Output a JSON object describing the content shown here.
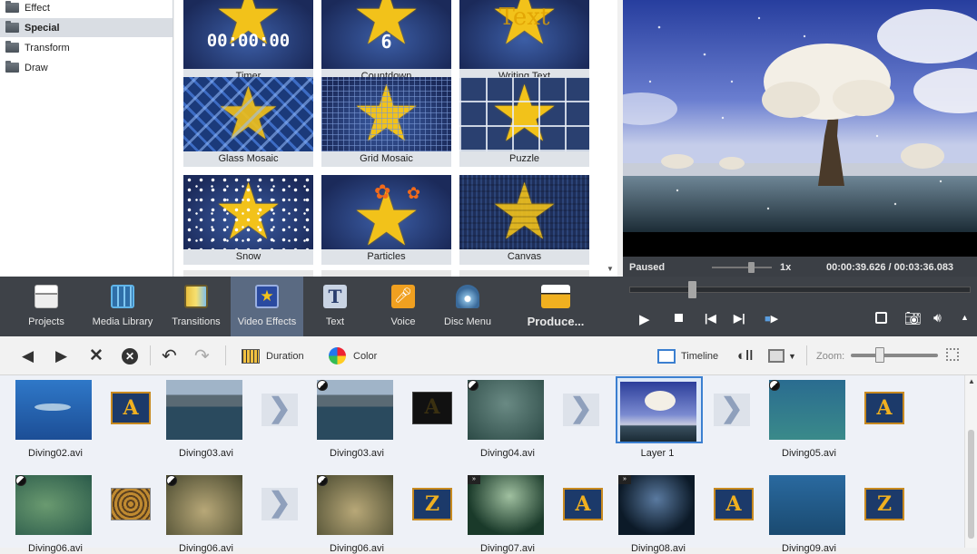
{
  "categories": {
    "items": [
      {
        "label": "Effect",
        "selected": false
      },
      {
        "label": "Special",
        "selected": true
      },
      {
        "label": "Transform",
        "selected": false
      },
      {
        "label": "Draw",
        "selected": false
      }
    ]
  },
  "gallery": {
    "tiles": [
      {
        "label": "Timer",
        "overlay": "00:00:00"
      },
      {
        "label": "Countdown",
        "overlay": "6"
      },
      {
        "label": "Writing Text",
        "overlay": "Text"
      },
      {
        "label": "Glass Mosaic"
      },
      {
        "label": "Grid Mosaic"
      },
      {
        "label": "Puzzle"
      },
      {
        "label": "Snow"
      },
      {
        "label": "Particles"
      },
      {
        "label": "Canvas"
      }
    ]
  },
  "preview": {
    "status": "Paused",
    "speed": "1x",
    "time": "00:00:39.626 / 00:03:36.083"
  },
  "toolbar": {
    "items": [
      {
        "label": "Projects",
        "icon": "clapperboard-icon"
      },
      {
        "label": "Media Library",
        "icon": "film-strip-icon"
      },
      {
        "label": "Transitions",
        "icon": "transitions-icon"
      },
      {
        "label": "Video Effects",
        "icon": "star-effect-icon",
        "active": true
      },
      {
        "label": "Text",
        "icon": "text-t-icon"
      },
      {
        "label": "Voice",
        "icon": "microphone-icon"
      },
      {
        "label": "Disc Menu",
        "icon": "disc-icon"
      },
      {
        "label": "Produce...",
        "icon": "produce-icon"
      }
    ]
  },
  "editbar": {
    "duration_label": "Duration",
    "color_label": "Color",
    "timeline_label": "Timeline",
    "zoom_label": "Zoom:"
  },
  "storyboard": {
    "row1": [
      "Diving02.avi",
      "Diving03.avi",
      "Diving03.avi",
      "Diving04.avi",
      "Layer 1",
      "Diving05.avi"
    ],
    "row2": [
      "Diving06.avi",
      "Diving06.avi",
      "Diving06.avi",
      "Diving07.avi",
      "Diving08.avi",
      "Diving09.avi"
    ]
  },
  "colors": {
    "toolbar_bg": "#3e4248",
    "active_tool": "#5a6a82",
    "accent": "#2f74c0",
    "star": "#f2c21a"
  }
}
